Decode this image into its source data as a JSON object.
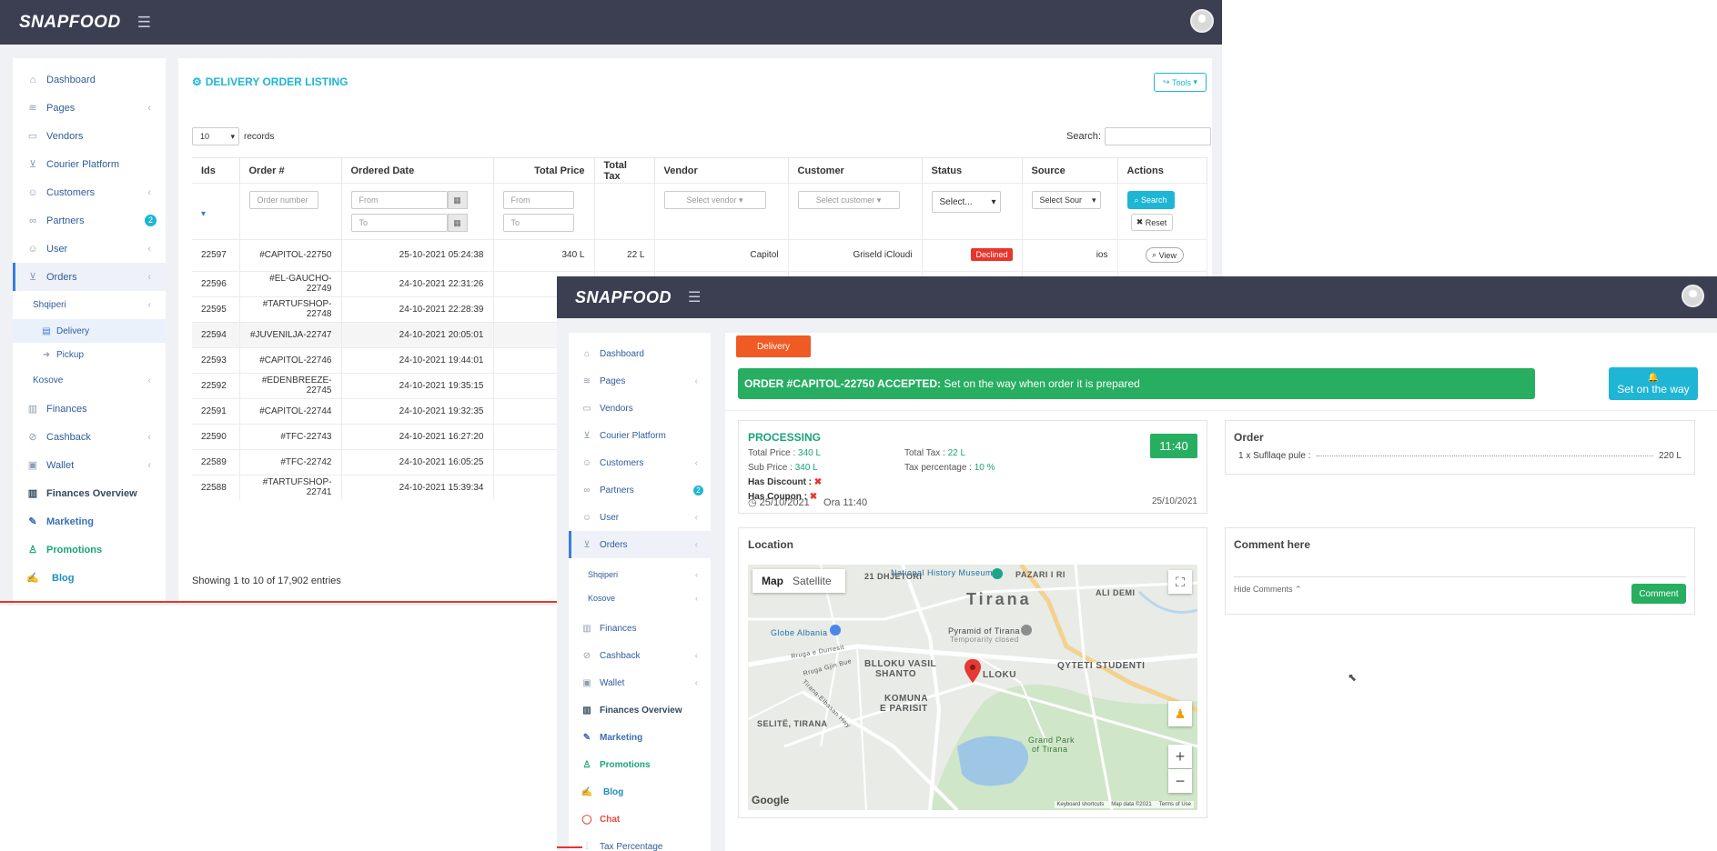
{
  "back": {
    "logo": "SNAPFOOD",
    "title": "DELIVERY ORDER LISTING",
    "tools": "Tools",
    "records_value": "10",
    "records_label": "records",
    "search_label": "Search:",
    "columns": [
      "Ids",
      "Order #",
      "Ordered Date",
      "Total Price",
      "Total Tax",
      "Vendor",
      "Customer",
      "Status",
      "Source",
      "Actions"
    ],
    "filters": {
      "order": "Order number",
      "date_from": "From",
      "date_to": "To",
      "price_from": "From",
      "price_to": "To",
      "vendor": "Select vendor",
      "customer": "Select customer",
      "status": "Select...",
      "source": "Select Sour",
      "search_btn": "Search",
      "reset_btn": "Reset"
    },
    "first_row": {
      "id": "22597",
      "order": "#CAPITOL-22750",
      "date": "25-10-2021 05:24:38",
      "price": "340 L",
      "tax": "22 L",
      "vendor": "Capitol",
      "customer": "Griseld iCloudi",
      "status": "Declined",
      "source": "ios",
      "action": "View"
    },
    "rows": [
      {
        "id": "22596",
        "order": "#EL-GAUCHO-22749",
        "date": "24-10-2021 22:31:26"
      },
      {
        "id": "22595",
        "order": "#TARTUFSHOP-22748",
        "date": "24-10-2021 22:28:39"
      },
      {
        "id": "22594",
        "order": "#JUVENILJA-22747",
        "date": "24-10-2021 20:05:01"
      },
      {
        "id": "22593",
        "order": "#CAPITOL-22746",
        "date": "24-10-2021 19:44:01"
      },
      {
        "id": "22592",
        "order": "#EDENBREEZE-22745",
        "date": "24-10-2021 19:35:15"
      },
      {
        "id": "22591",
        "order": "#CAPITOL-22744",
        "date": "24-10-2021 19:32:35"
      },
      {
        "id": "22590",
        "order": "#TFC-22743",
        "date": "24-10-2021 16:27:20"
      },
      {
        "id": "22589",
        "order": "#TFC-22742",
        "date": "24-10-2021 16:05:25"
      },
      {
        "id": "22588",
        "order": "#TARTUFSHOP-22741",
        "date": "24-10-2021 15:39:34"
      }
    ],
    "footer": "Showing 1 to 10 of 17,902 entries",
    "sidebar": {
      "dashboard": "Dashboard",
      "pages": "Pages",
      "vendors": "Vendors",
      "courier": "Courier Platform",
      "customers": "Customers",
      "partners": "Partners",
      "partners_badge": "2",
      "user": "User",
      "orders": "Orders",
      "shqiperi": "Shqiperi",
      "delivery": "Delivery",
      "pickup": "Pickup",
      "kosove": "Kosove",
      "finances": "Finances",
      "cashback": "Cashback",
      "wallet": "Wallet",
      "fin_overview": "Finances Overview",
      "marketing": "Marketing",
      "promotions": "Promotions",
      "blog": "Blog"
    }
  },
  "front": {
    "logo": "SNAPFOOD",
    "tab": "Delivery",
    "banner_strong": "ORDER #CAPITOL-22750 ACCEPTED:",
    "banner_text": "Set on the way when order it is prepared",
    "set_on_way": "Set on the way",
    "status": "PROCESSING",
    "timer": "11:40",
    "total_price_lbl": "Total Price :",
    "total_price": "340 L",
    "total_tax_lbl": "Total Tax :",
    "total_tax": "22 L",
    "sub_price_lbl": "Sub Price :",
    "sub_price": "340 L",
    "tax_pct_lbl": "Tax percentage :",
    "tax_pct": "10 %",
    "has_discount": "Has Discount :",
    "has_coupon": "Has Coupon :",
    "date": "25/10/2021",
    "ora": "Ora 11:40",
    "date_right": "25/10/2021",
    "order_title": "Order",
    "order_item": "1 x Sufllaqe pule :",
    "order_item_price": "220 L",
    "location_title": "Location",
    "comment_title": "Comment here",
    "hide_comments": "Hide Comments",
    "comment_btn": "Comment",
    "map": {
      "tab_map": "Map",
      "tab_sat": "Satellite",
      "city": "Tirana",
      "labels": [
        "National History Museum",
        "PAZARI I RI",
        "21 DHJETORI",
        "ALI DEMI",
        "Globe Albania",
        "Pyramid of Tirana",
        "Temporarily closed",
        "BLLOKU VASIL",
        "SHANTO",
        "LLOKU",
        "QYTETI STUDENTI",
        "KOMUNA",
        "E PARISIT",
        "SELITË, TIRANA",
        "Grand Park",
        "of Tirana",
        "Rruga e Durresit",
        "Tirana-Elbasan Hwy",
        "Rruga Gjin Bue"
      ],
      "footer": [
        "Keyboard shortcuts",
        "Map data ©2021",
        "Terms of Use"
      ],
      "google": "Google"
    },
    "sidebar": {
      "dashboard": "Dashboard",
      "pages": "Pages",
      "vendors": "Vendors",
      "courier": "Courier Platform",
      "customers": "Customers",
      "partners": "Partners",
      "partners_badge": "2",
      "user": "User",
      "orders": "Orders",
      "shqiperi": "Shqiperi",
      "kosove": "Kosove",
      "finances": "Finances",
      "cashback": "Cashback",
      "wallet": "Wallet",
      "fin_overview": "Finances Overview",
      "marketing": "Marketing",
      "promotions": "Promotions",
      "blog": "Blog",
      "chat": "Chat",
      "tax": "Tax Percentage"
    }
  },
  "colors": {
    "topbar": "#3c3f52",
    "accent": "#1fb5d4",
    "green": "#27ae60",
    "orange": "#f05a24",
    "declined": "#e8352b"
  }
}
